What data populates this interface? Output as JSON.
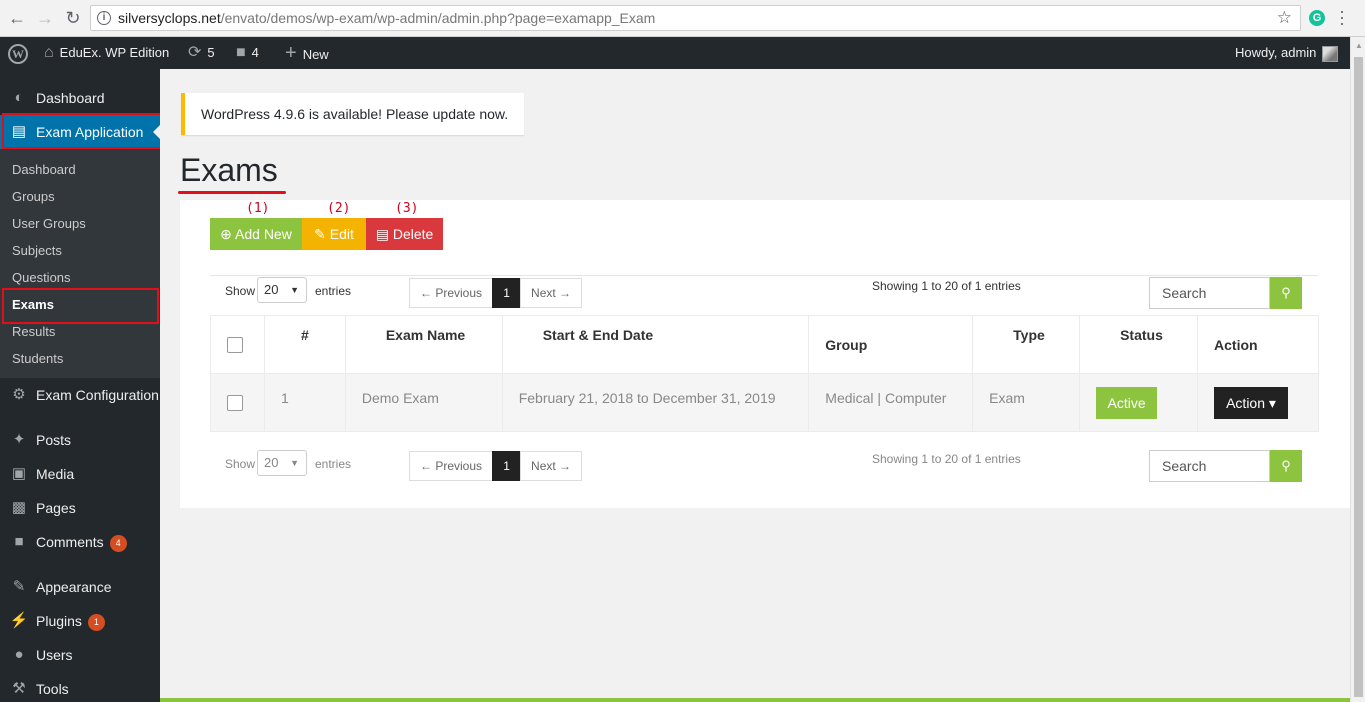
{
  "browser": {
    "url_host": "silversyclops.net",
    "url_path": "/envato/demos/wp-exam/wp-admin/admin.php?page=examapp_Exam",
    "extension_letter": "G"
  },
  "adminbar": {
    "site_name": "EduEx. WP Edition",
    "updates_count": "5",
    "comments_count": "4",
    "new_label": "New",
    "howdy": "Howdy, admin"
  },
  "sidebar": {
    "dashboard": "Dashboard",
    "exam_application": "Exam Application",
    "submenu": [
      "Dashboard",
      "Groups",
      "User Groups",
      "Subjects",
      "Questions",
      "Exams",
      "Results",
      "Students"
    ],
    "exam_configuration": "Exam Configuration",
    "posts": "Posts",
    "media": "Media",
    "pages": "Pages",
    "comments": "Comments",
    "comments_badge": "4",
    "appearance": "Appearance",
    "plugins": "Plugins",
    "plugins_badge": "1",
    "users": "Users",
    "tools": "Tools"
  },
  "notice": "WordPress 4.9.6 is available! Please update now.",
  "page_title": "Exams",
  "annotations": [
    "(1)",
    "(2)",
    "(3)"
  ],
  "toolbar": {
    "add_new": "Add New",
    "edit": "Edit",
    "delete": "Delete"
  },
  "controls_top": {
    "show": "Show",
    "entries_value": "20",
    "entries": "entries",
    "previous": "← Previous",
    "page": "1",
    "next": "Next →",
    "showing": "Showing 1 to 20 of 1 entries",
    "search_placeholder": "Search"
  },
  "controls_bottom": {
    "show": "Show",
    "entries_value": "20",
    "entries": "entries",
    "previous": "← Previous",
    "page": "1",
    "next": "Next →",
    "showing": "Showing 1 to 20 of 1 entries",
    "search_placeholder": "Search"
  },
  "table": {
    "headers": [
      "#",
      "Exam Name",
      "Start & End Date",
      "Group",
      "Type",
      "Status",
      "Action"
    ],
    "rows": [
      {
        "num": "1",
        "name": "Demo Exam",
        "dates": "February 21, 2018 to December 31, 2019",
        "group": "Medical | Computer",
        "type": "Exam",
        "status": "Active",
        "action": "Action ▾"
      }
    ]
  },
  "colors": {
    "admin_dark": "#23282d",
    "wp_blue": "#0073aa",
    "green": "#8cc43f",
    "orange": "#f4b300",
    "red": "#d9383c",
    "highlight": "#e0101a"
  }
}
